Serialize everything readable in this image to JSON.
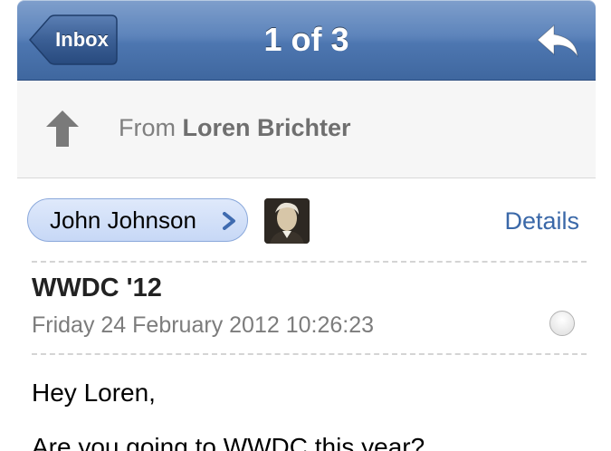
{
  "navbar": {
    "back_label": "Inbox",
    "title": "1 of 3",
    "reply_icon": "reply-arrow-icon"
  },
  "from_bar": {
    "prefix": "From",
    "name": "Loren Brichter",
    "icon": "up-arrow-icon"
  },
  "message": {
    "sender": "John Johnson",
    "details_label": "Details",
    "subject": "WWDC '12",
    "date": "Friday 24 February 2012 10:26:23",
    "greeting": "Hey Loren,",
    "body_line2": "Are you going to WWDC this year?"
  },
  "colors": {
    "nav_blue": "#4d76b0",
    "link_blue": "#3a68a8",
    "pill_blue": "#c7d8f6"
  }
}
